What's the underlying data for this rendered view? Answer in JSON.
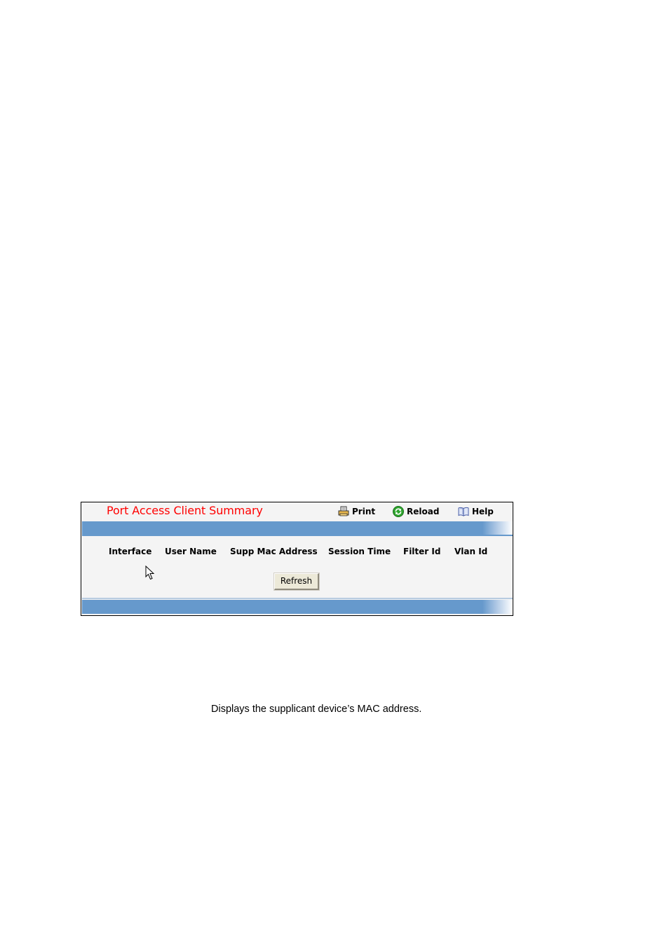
{
  "panel": {
    "title": "Port Access Client Summary",
    "title_color": "#ff0000",
    "toolbar": [
      {
        "label": "Print",
        "icon": "printer-icon"
      },
      {
        "label": "Reload",
        "icon": "reload-icon"
      },
      {
        "label": "Help",
        "icon": "book-icon"
      }
    ],
    "bar_color": "#6699cc",
    "table": {
      "columns": [
        "Interface",
        "User Name",
        "Supp Mac Address",
        "Session Time",
        "Filter Id",
        "Vlan Id"
      ],
      "rows": []
    },
    "refresh_label": "Refresh"
  },
  "document": {
    "description": "Displays the supplicant device’s MAC address."
  }
}
